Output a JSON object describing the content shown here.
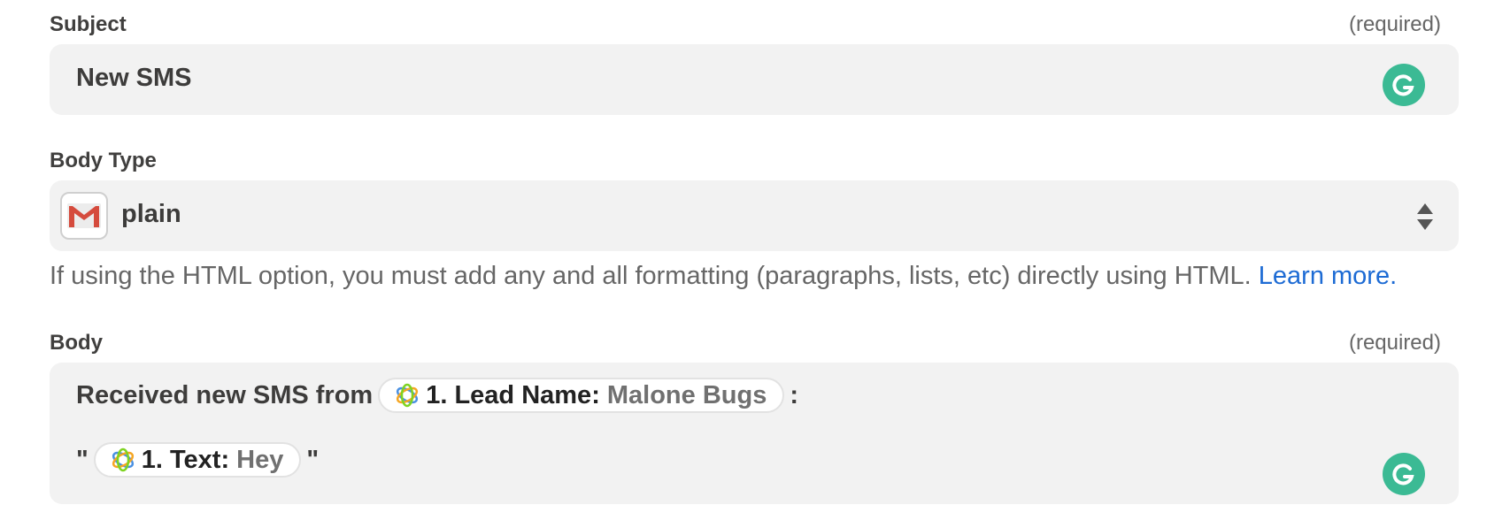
{
  "subject": {
    "label": "Subject",
    "required": "(required)",
    "value": "New SMS"
  },
  "body_type": {
    "label": "Body Type",
    "value": "plain",
    "help_text": "If using the HTML option, you must add any and all formatting (paragraphs, lists, etc) directly using HTML.",
    "learn_more": "Learn more."
  },
  "body": {
    "label": "Body",
    "required": "(required)",
    "line1_prefix": "Received new SMS from",
    "line1_suffix": ":",
    "pill1": {
      "name": "1. Lead Name:",
      "value": "Malone Bugs"
    },
    "line2_open": "\"",
    "line2_close": "\"",
    "pill2": {
      "name": "1. Text:",
      "value": "Hey"
    }
  },
  "colors": {
    "link": "#1d6bd4",
    "grammarly": "#3bba94",
    "field_bg": "#f2f2f2"
  },
  "icons": [
    "grammarly-icon",
    "gmail-icon",
    "select-stepper-icon",
    "app-logo-icon"
  ]
}
